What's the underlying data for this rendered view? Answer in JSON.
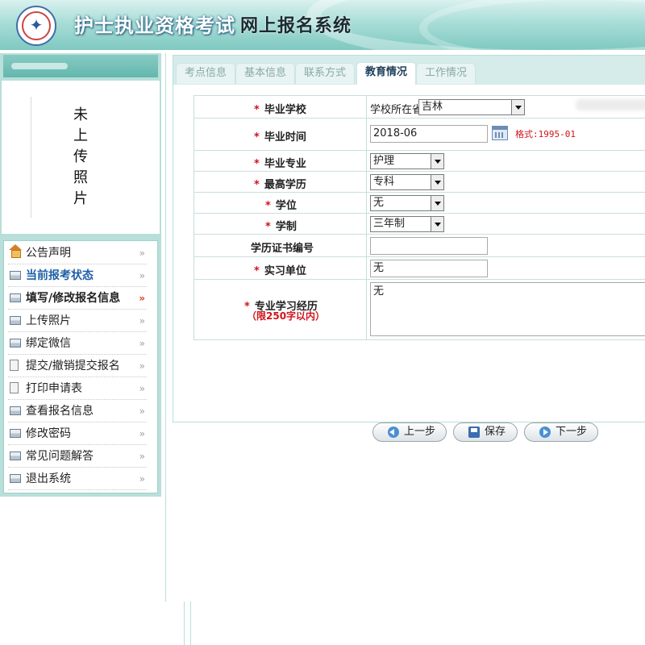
{
  "header": {
    "title_part1": "护士执业资格考试",
    "title_part2": "网上报名系统",
    "logo_icon": "emblem-icon"
  },
  "sidebar": {
    "photo_placeholder": "未上传照片",
    "menu": [
      {
        "label": "公告声明",
        "icon": "house-icon",
        "style": "normal"
      },
      {
        "label": "当前报考状态",
        "icon": "card-icon",
        "style": "active"
      },
      {
        "label": "填写/修改报名信息",
        "icon": "card-icon",
        "style": "bold"
      },
      {
        "label": "上传照片",
        "icon": "card-icon",
        "style": "normal"
      },
      {
        "label": "绑定微信",
        "icon": "card-icon",
        "style": "normal"
      },
      {
        "label": "提交/撤销提交报名",
        "icon": "document-icon",
        "style": "normal"
      },
      {
        "label": "打印申请表",
        "icon": "document-icon",
        "style": "normal"
      },
      {
        "label": "查看报名信息",
        "icon": "card-icon",
        "style": "normal"
      },
      {
        "label": "修改密码",
        "icon": "card-icon",
        "style": "normal"
      },
      {
        "label": "常见问题解答",
        "icon": "card-icon",
        "style": "normal"
      },
      {
        "label": "退出系统",
        "icon": "card-icon",
        "style": "normal"
      }
    ],
    "arrow_glyph": "»"
  },
  "tabs": [
    {
      "label": "考点信息",
      "active": false
    },
    {
      "label": "基本信息",
      "active": false
    },
    {
      "label": "联系方式",
      "active": false
    },
    {
      "label": "教育情况",
      "active": true
    },
    {
      "label": "工作情况",
      "active": false
    }
  ],
  "form": {
    "required_mark": "*",
    "graduation_school": {
      "label": "毕业学校",
      "province_prefix": "学校所在省",
      "province_value": "吉林"
    },
    "graduation_time": {
      "label": "毕业时间",
      "value": "2018-06",
      "format_hint": "格式:1995-01"
    },
    "major": {
      "label": "毕业专业",
      "value": "护理"
    },
    "highest_education": {
      "label": "最高学历",
      "value": "专科"
    },
    "degree": {
      "label": "学位",
      "value": "无"
    },
    "schooling_length": {
      "label": "学制",
      "value": "三年制"
    },
    "certificate_number": {
      "label": "学历证书编号",
      "value": ""
    },
    "internship_unit": {
      "label": "实习单位",
      "value": "无"
    },
    "study_experience": {
      "label": "专业学习经历",
      "limit_note": "（限250字以内）",
      "value": "无"
    }
  },
  "buttons": {
    "prev": "上一步",
    "save": "保存",
    "next": "下一步"
  }
}
